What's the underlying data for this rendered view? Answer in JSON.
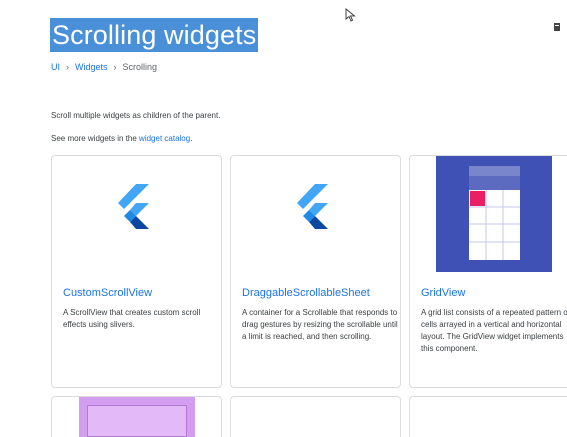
{
  "page": {
    "title": "Scrolling widgets",
    "breadcrumb": [
      "UI",
      "Widgets",
      "Scrolling"
    ],
    "intro": "Scroll multiple widgets as children of the parent.",
    "see_more_prefix": "See more widgets in the ",
    "see_more_link": "widget catalog",
    "see_more_suffix": "."
  },
  "cards": [
    {
      "title": "CustomScrollView",
      "description": "A ScrollView that creates custom scroll effects using slivers.",
      "icon": "flutter-logo-icon"
    },
    {
      "title": "DraggableScrollableSheet",
      "description": "A container for a Scrollable that responds to drag gestures by resizing the scrollable until a limit is reached, and then scrolling.",
      "icon": "flutter-logo-icon"
    },
    {
      "title": "GridView",
      "description": "A grid list consists of a repeated pattern of cells arrayed in a vertical and horizontal layout. The GridView widget implements this component.",
      "icon": "gridview-illustration"
    }
  ],
  "colors": {
    "link": "#1a73e8",
    "title_highlight": "#4a90d9",
    "flutter_light": "#42a5f5",
    "flutter_dark": "#0d47a1",
    "grid_bg": "#3f51b5",
    "grid_header": "#6a7fd6",
    "grid_accent": "#e91e63"
  }
}
